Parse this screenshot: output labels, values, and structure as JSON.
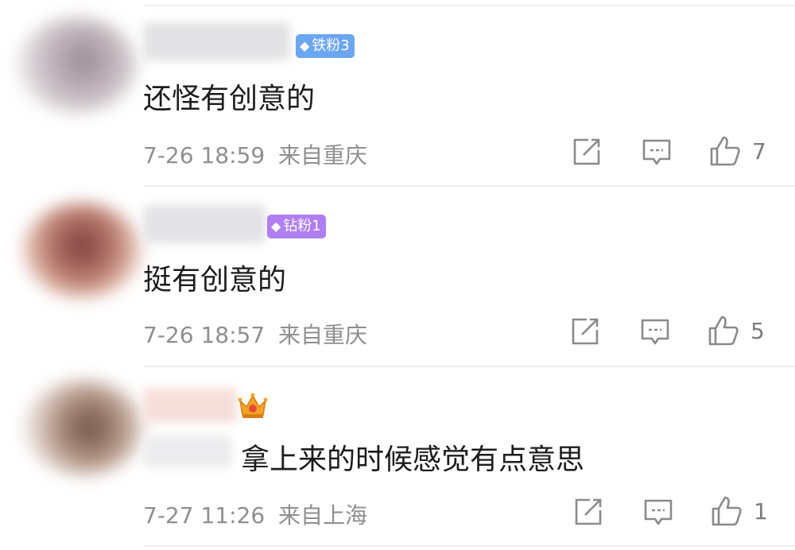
{
  "comments": [
    {
      "badge": {
        "text": "铁粉3",
        "color": "#6ba6f3"
      },
      "text": "还怪有创意的",
      "time": "7-26 18:59",
      "location": "来自重庆",
      "likes": "7"
    },
    {
      "badge": {
        "text": "钻粉1",
        "color": "#b07ef2"
      },
      "text": "挺有创意的",
      "time": "7-26 18:57",
      "location": "来自重庆",
      "likes": "5"
    },
    {
      "badge": {
        "text": "",
        "color": "#f0a020"
      },
      "text": "拿上来的时候感觉有点意思",
      "time": "7-27 11:26",
      "location": "来自上海",
      "likes": "1"
    }
  ],
  "icons": {
    "share": "share-icon",
    "reply": "comment-icon",
    "like": "thumbs-up-icon",
    "rank": "crown-icon"
  }
}
